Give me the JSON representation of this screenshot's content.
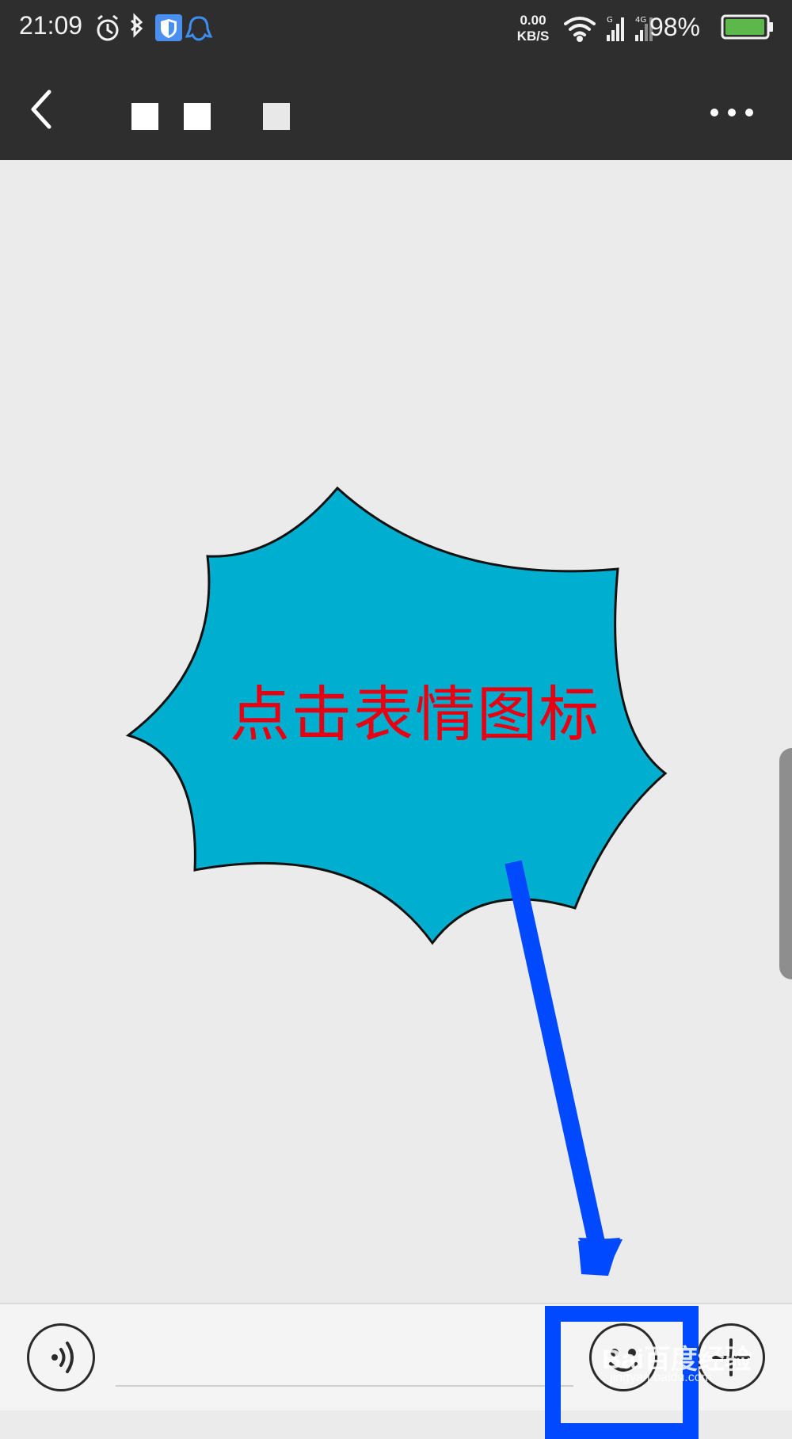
{
  "status_bar": {
    "time": "21:09",
    "net_speed_value": "0.00",
    "net_speed_unit": "KB/S",
    "battery_percent": "98%",
    "icons": [
      "alarm-icon",
      "bluetooth-icon",
      "shield-icon",
      "qq-icon",
      "wifi-icon",
      "signal-icon",
      "signal-4g-icon",
      "battery-icon"
    ],
    "battery_level": 0.98
  },
  "nav_bar": {
    "back_icon": "chevron-left-icon",
    "more_icon": "more-dots-icon"
  },
  "annotation": {
    "callout_text": "点击表情图标",
    "callout_fill": "#00aecf",
    "callout_text_color": "#e60012",
    "arrow_color": "#0049ff",
    "highlight_color": "#0049ff"
  },
  "input_bar": {
    "voice_icon": "voice-icon",
    "emoji_icon": "emoji-icon",
    "plus_icon": "plus-icon",
    "message_value": ""
  },
  "watermark": {
    "text": "Bai百度经验",
    "sub": "jingyan.baidu.com"
  }
}
